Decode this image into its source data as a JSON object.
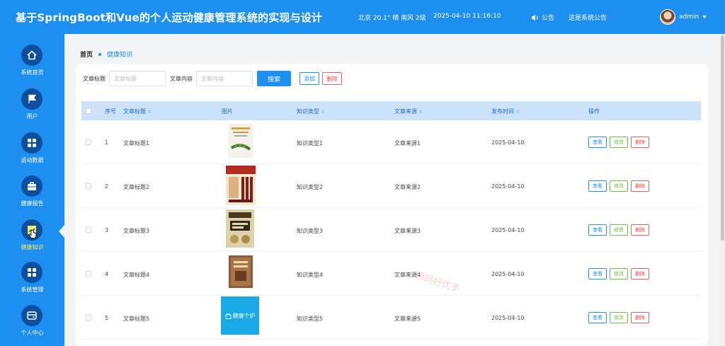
{
  "header": {
    "title": "基于SpringBoot和Vue的个人运动健康管理系统的实现与设计",
    "weather": "北京  20.1° 晴  南风 2级",
    "datetime": "2025-04-10 11:16:10",
    "notice_label": "公告",
    "notice_text": "这是系统公告",
    "username": "admin"
  },
  "sidebar": {
    "items": [
      {
        "label": "系统首页",
        "icon": "home-icon"
      },
      {
        "label": "用户",
        "icon": "flag-icon"
      },
      {
        "label": "运动数据",
        "icon": "grid-icon"
      },
      {
        "label": "健康报告",
        "icon": "briefcase-icon"
      },
      {
        "label": "健康知识",
        "icon": "chart-icon",
        "active": true
      },
      {
        "label": "系统管理",
        "icon": "grid-icon"
      },
      {
        "label": "个人中心",
        "icon": "card-icon"
      }
    ]
  },
  "breadcrumb": {
    "home": "首页",
    "current": "健康知识"
  },
  "search": {
    "title_label": "文章标题",
    "title_placeholder": "文章标题",
    "content_label": "文章内容",
    "content_placeholder": "文章内容",
    "search_button": "搜索",
    "add_button": "添加",
    "delete_button": "删除"
  },
  "table": {
    "headers": {
      "index": "序号",
      "title": "文章标题",
      "image": "图片",
      "type": "知识类型",
      "source": "文章来源",
      "date": "发布时间",
      "ops": "操作"
    },
    "ops": {
      "view": "查看",
      "edit": "修改",
      "del": "删除"
    },
    "rows": [
      {
        "index": "1",
        "title": "文章标题1",
        "type": "知识类型1",
        "source": "文章来源1",
        "date": "2025-04-10"
      },
      {
        "index": "2",
        "title": "文章标题2",
        "type": "知识类型2",
        "source": "文章来源2",
        "date": "2025-04-10"
      },
      {
        "index": "3",
        "title": "文章标题3",
        "type": "知识类型3",
        "source": "文章来源3",
        "date": "2025-04-10"
      },
      {
        "index": "4",
        "title": "文章标题4",
        "type": "知识类型4",
        "source": "文章来源4",
        "date": "2025-04-10"
      },
      {
        "index": "5",
        "title": "文章标题5",
        "type": "知识类型5",
        "source": "文章来源5",
        "date": "2025-04-10",
        "image_text": "健康个护"
      }
    ]
  },
  "watermark": "源码好优多"
}
